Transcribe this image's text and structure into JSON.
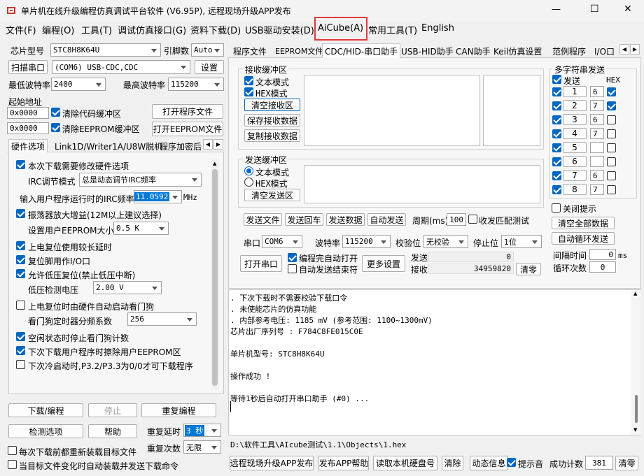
{
  "titlebar": {
    "title": "单片机在线升级编程仿真调试平台软件 (V6.95P), 远程现场升级APP发布",
    "min": "—",
    "max": "☐",
    "close": "✕"
  },
  "menu": [
    "文件(F)",
    "编程(O)",
    "工具(T)",
    "调试仿真接口(G)",
    "资料下载(D)",
    "USB驱动安装(D)",
    "AiCube(A)",
    "常用工具(T)",
    "English"
  ],
  "left": {
    "chip_label": "芯片型号",
    "chip_value": "STC8H8K64U",
    "pins_label": "引脚数",
    "pins_value": "Auto",
    "scan_btn": "扫描串口",
    "port_value": "(COM6) USB-CDC,CDC",
    "settings_btn": "设置",
    "min_baud_label": "最低波特率",
    "min_baud": "2400",
    "max_baud_label": "最高波特率",
    "max_baud": "115200",
    "start_addr_label": "起始地址",
    "addr1": "0x0000",
    "clear_code": "清除代码缓冲区",
    "open_prog": "打开程序文件",
    "addr2": "0x0000",
    "clear_eeprom": "清除EEPROM缓冲区",
    "open_eeprom": "打开EEPROM文件",
    "tabs": [
      "硬件选项",
      "Link1D/Writer1A/U8W脱机",
      "程序加密后"
    ],
    "opts": {
      "o1": "本次下载需要修改硬件选项",
      "irc_label": "IRC调节模式",
      "irc_value": "总是动态调节IRC频率",
      "freq_label": "输入用户程序运行时的IRC频率",
      "freq_value": "11.0592",
      "freq_unit": "MHz",
      "o2": "振荡器放大增益(12M以上建议选择)",
      "eeprom_label": "设置用户EEPROM大小",
      "eeprom_value": "0.5 K",
      "o3": "上电复位使用较长延时",
      "o4": "复位脚用作I/O口",
      "o5": "允许低压复位(禁止低压中断)",
      "lv_label": "低压检测电压",
      "lv_value": "2.00 V",
      "o6": "上电复位时由硬件自动启动看门狗",
      "wdt_label": "看门狗定时器分频系数",
      "wdt_value": "256",
      "o7": "空闲状态时停止看门狗计数",
      "o8": "下次下载用户程序时擦除用户EEPROM区",
      "o9": "下次冷启动时,P3.2/P3.3为0/0才可下载程序"
    },
    "download_btn": "下载/编程",
    "stop_btn": "停止",
    "reprog_btn": "重复编程",
    "detect_btn": "检测选项",
    "help_btn": "帮助",
    "repeat_delay_label": "重复延时",
    "repeat_delay": "3 秒",
    "repeat_count_label": "重复次数",
    "repeat_count": "无限",
    "reload_chk": "每次下载前都重新装载目标文件",
    "auto_chk": "当目标文件变化时自动装载并发送下载命令"
  },
  "right": {
    "tabs": [
      "程序文件",
      "EEPROM文件",
      "CDC/HID-串口助手",
      "USB-HID助手",
      "CAN助手",
      "Keil仿真设置",
      "范例程序",
      "I/O口"
    ],
    "recv": {
      "title": "接收缓冲区",
      "text_mode": "文本模式",
      "hex_mode": "HEX模式",
      "clear": "清空接收区",
      "save": "保存接收数据",
      "copy": "复制接收数据"
    },
    "send": {
      "title": "发送缓冲区",
      "text_mode": "文本模式",
      "hex_mode": "HEX模式",
      "clear": "清空发送区"
    },
    "multi": {
      "title": "多字符串发送",
      "send_hdr": "发送",
      "hex_hdr": "HEX",
      "rows": [
        {
          "n": "1",
          "v": "6"
        },
        {
          "n": "2",
          "v": "7"
        },
        {
          "n": "3",
          "v": "6"
        },
        {
          "n": "4",
          "v": "7"
        },
        {
          "n": "5",
          "v": ""
        },
        {
          "n": "6",
          "v": ""
        },
        {
          "n": "7",
          "v": "6"
        },
        {
          "n": "8",
          "v": "7"
        }
      ],
      "close_hint": "关闭提示",
      "clear_all": "清空全部数据",
      "auto_loop": "自动循环发送",
      "interval_label": "间隔时间",
      "interval": "0",
      "interval_unit": "ms",
      "loops_label": "循环次数",
      "loops": "0"
    },
    "send_file": "发送文件",
    "send_back": "发送回车",
    "send_data": "发送数据",
    "auto_send": "自动发送",
    "period_label": "周期(ms)",
    "period": "100",
    "rx_match": "收发匹配测试",
    "port_label": "串口",
    "port": "COM6",
    "baud_label": "波特率",
    "baud": "115200",
    "parity_label": "校验位",
    "parity": "无校验",
    "stop_label": "停止位",
    "stop": "1位",
    "open_port": "打开串口",
    "auto_open": "编程完自动打开",
    "auto_end": "自动发送结束符",
    "more": "更多设置",
    "tx_label": "发送",
    "tx": "0",
    "rx_label": "接收",
    "rx": "34959820",
    "clear": "清零"
  },
  "log": [
    ". 下次下载时不需要校验下载口令",
    ". 未使能芯片的仿真功能",
    ". 内部参考电压: 1185 mV (参考范围: 1100~1300mV)",
    "芯片出厂序列号 : F784C8FE015C0E",
    "",
    "  单片机型号: STC8H8K64U",
    "",
    "操作成功 !",
    "",
    "等待1秒后自动打开串口助手 (#0) ..."
  ],
  "path": "D:\\软件工具\\AIcube测试\\1.1\\Objects\\1.hex",
  "bottom": {
    "remote": "远程现场升级APP发布",
    "app_help": "发布APP帮助",
    "read_disk": "读取本机硬盘号",
    "clear": "清除",
    "dyn": "动态信息",
    "hint": "提示音",
    "success_label": "成功计数",
    "success": "381",
    "clear2": "清零"
  },
  "colors": {
    "accent": "#0067c0",
    "highlight_border": "#e0393e"
  }
}
